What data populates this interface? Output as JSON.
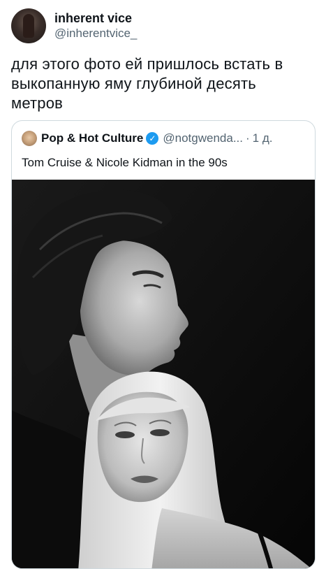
{
  "author": {
    "display_name": "inherent vice",
    "handle": "@inherentvice_"
  },
  "tweet": {
    "text": "для этого фото ей пришлось встать в выкопанную яму глубиной десять метров"
  },
  "quote": {
    "display_name": "Pop & Hot Culture",
    "verified_glyph": "✓",
    "handle": "@notgwenda...",
    "separator": "·",
    "time": "1 д.",
    "text": "Tom Cruise & Nicole Kidman in the 90s"
  },
  "icons": {
    "avatar": "profile-photo",
    "verified": "verified-badge-icon"
  },
  "colors": {
    "verified_blue": "#1d9bf0",
    "secondary_text": "#536471",
    "border": "#cfd9de"
  }
}
